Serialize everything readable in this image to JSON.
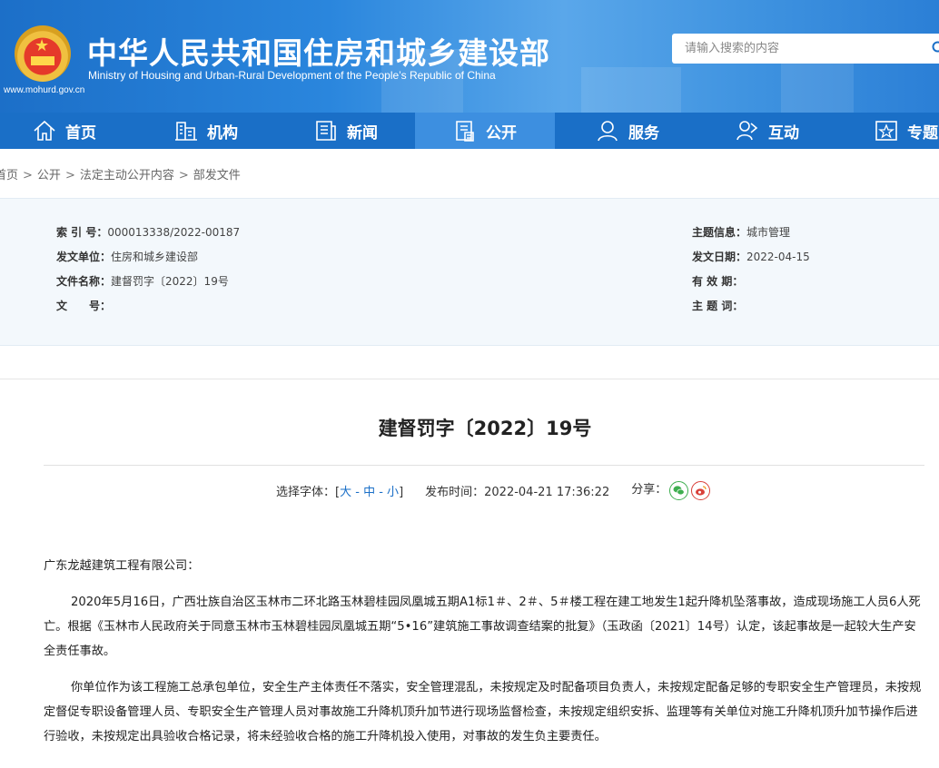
{
  "header": {
    "site_title": "中华人民共和国住房和城乡建设部",
    "site_subtitle": "Ministry of Housing and Urban-Rural Development of the People’s Republic of China",
    "site_url": "www.mohurd.gov.cn",
    "search_placeholder": "请输入搜索的内容"
  },
  "nav": {
    "items": [
      {
        "label": "首页",
        "icon": "home-icon"
      },
      {
        "label": "机构",
        "icon": "building-icon"
      },
      {
        "label": "新闻",
        "icon": "news-icon"
      },
      {
        "label": "公开",
        "icon": "document-icon",
        "active": true
      },
      {
        "label": "服务",
        "icon": "service-icon"
      },
      {
        "label": "互动",
        "icon": "interact-icon"
      },
      {
        "label": "专题",
        "icon": "star-box-icon"
      }
    ]
  },
  "breadcrumb": [
    "首页",
    "公开",
    "法定主动公开内容",
    "部发文件"
  ],
  "meta": {
    "left": [
      {
        "key": "索 引 号：",
        "value": "000013338/2022-00187"
      },
      {
        "key": "发文单位：",
        "value": "住房和城乡建设部"
      },
      {
        "key": "文件名称：",
        "value": "建督罚字〔2022〕19号"
      },
      {
        "key": "文　　号：",
        "value": ""
      }
    ],
    "right": [
      {
        "key": "主题信息：",
        "value": "城市管理"
      },
      {
        "key": "发文日期：",
        "value": "2022-04-15"
      },
      {
        "key": "有 效 期：",
        "value": ""
      },
      {
        "key": "主 题 词：",
        "value": ""
      }
    ]
  },
  "article": {
    "title": "建督罚字〔2022〕19号",
    "font_select_label": "选择字体：[",
    "font_large": "大",
    "font_medium": "中",
    "font_small": "小",
    "font_close": "]",
    "publish_time_label": "发布时间：2022-04-21 17:36:22",
    "share_label": "分享：",
    "salutation": "广东龙越建筑工程有限公司：",
    "paragraph1": "2020年5月16日，广西壮族自治区玉林市二环北路玉林碧桂园凤凰城五期A1标1＃、2＃、5＃楼工程在建工地发生1起升降机坠落事故，造成现场施工人员6人死亡。根据《玉林市人民政府关于同意玉林市玉林碧桂园凤凰城五期“5•16”建筑施工事故调查结案的批复》（玉政函〔2021〕14号）认定，该起事故是一起较大生产安全责任事故。",
    "paragraph2": "你单位作为该工程施工总承包单位，安全生产主体责任不落实，安全管理混乱，未按规定及时配备项目负责人，未按规定配备足够的专职安全生产管理员，未按规定督促专职设备管理人员、专职安全生产管理人员对事故施工升降机顶升加节进行现场监督检查，未按规定组织安拆、监理等有关单位对施工升降机顶升加节操作后进行验收，未按规定出具验收合格记录，将未经验收合格的施工升降机投入使用，对事故的发生负主要责任。"
  },
  "colors": {
    "header_blue": "#2a86dd",
    "nav_blue": "#1a6fc7",
    "nav_active": "#3d8fe0",
    "meta_bg": "#f3f8fc",
    "link": "#1a6fc7"
  }
}
